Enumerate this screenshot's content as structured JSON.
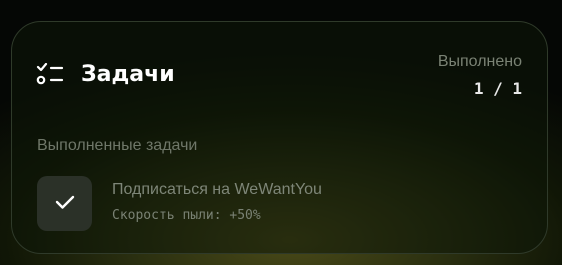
{
  "header": {
    "title": "Задачи",
    "icon": "task-list-icon"
  },
  "progress": {
    "label": "Выполнено",
    "count": "1 / 1",
    "completed": 1,
    "total": 1
  },
  "completed_section": {
    "label": "Выполненные задачи",
    "tasks": [
      {
        "title": "Подписаться на WeWantYou",
        "reward": "Скорость пыли: +50%",
        "status_icon": "check-icon",
        "done": true
      }
    ]
  },
  "colors": {
    "card_border": "#2f3a2a",
    "check_bg": "#2b3128",
    "title": "#ffffff",
    "muted_text": "#7a8274"
  }
}
